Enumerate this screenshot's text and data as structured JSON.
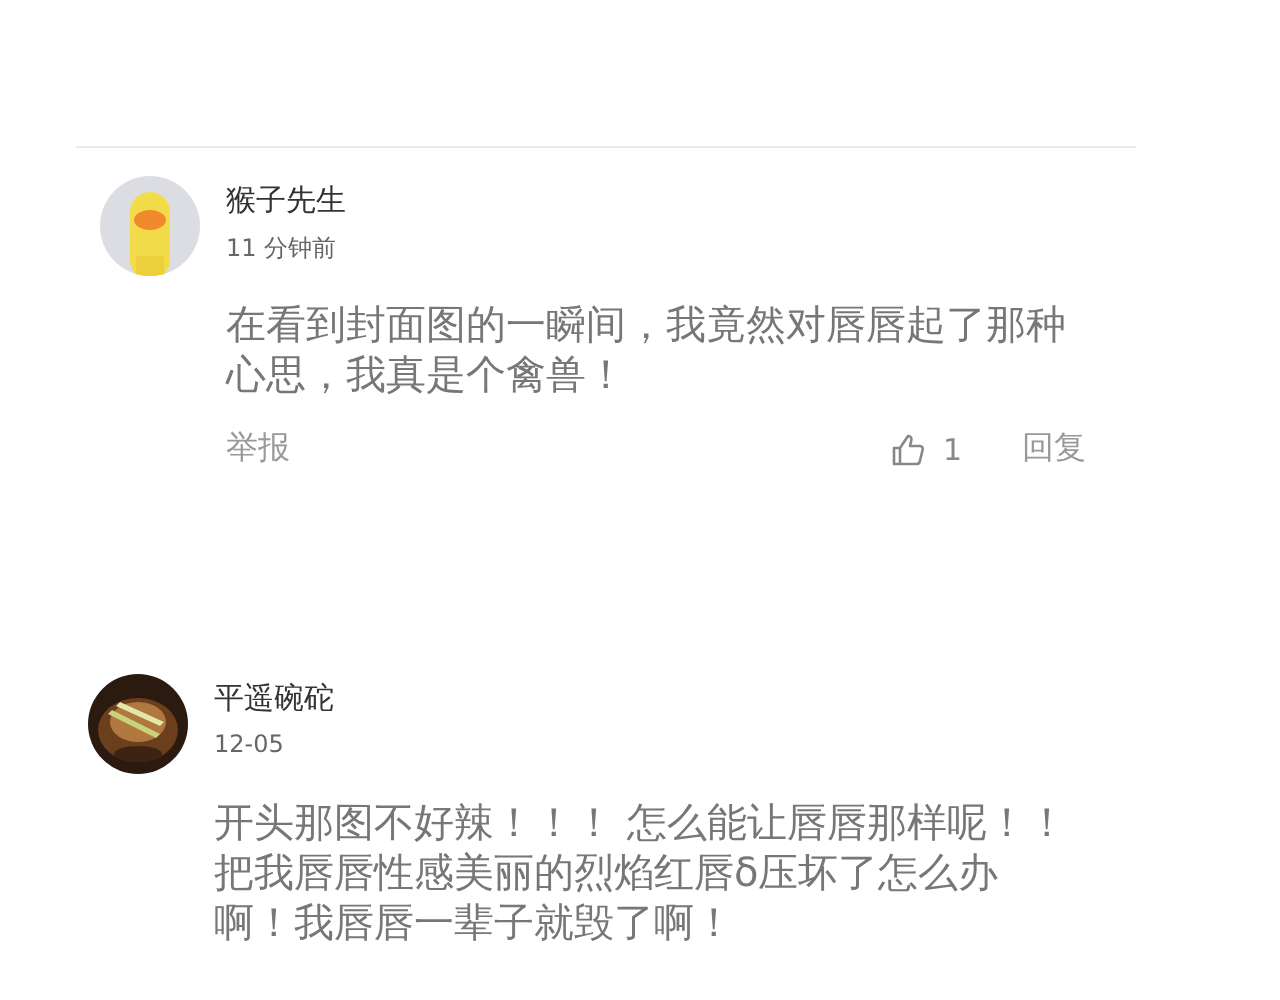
{
  "comments": [
    {
      "author": "猴子先生",
      "time": "11 分钟前",
      "text": "在看到封面图的一瞬间，我竟然对唇唇起了那种心思，我真是个禽兽！",
      "report": "举报",
      "likes": "1",
      "liked": false,
      "reply": "回复"
    },
    {
      "author": "平遥碗砣",
      "time": "12-05",
      "text": "开头那图不好辣！！！ 怎么能让唇唇那样呢！！把我唇唇性感美丽的烈焰红唇δ压坏了怎么办啊！我唇唇一辈子就毁了啊！"
    }
  ]
}
